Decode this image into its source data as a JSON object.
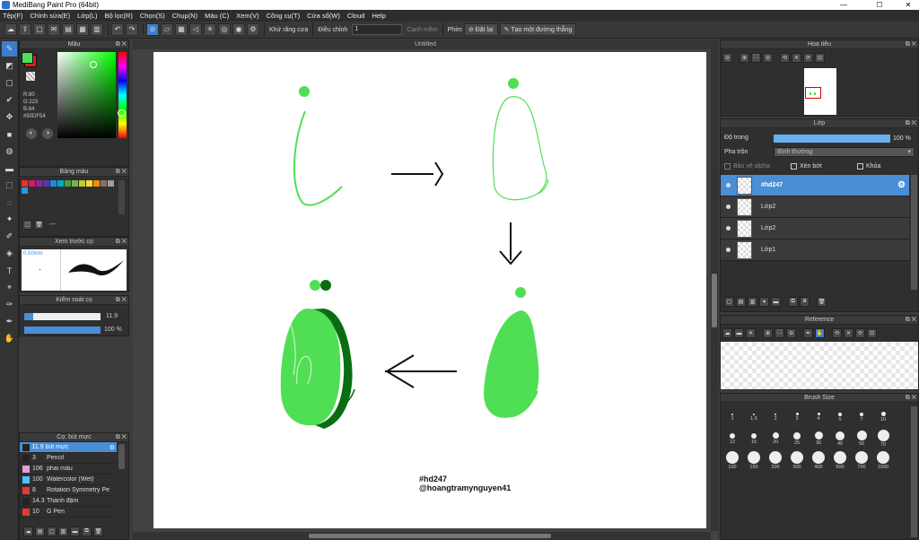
{
  "window": {
    "title": "MediBang Paint Pro (64bit)",
    "min": "—",
    "max": "☐",
    "close": "✕"
  },
  "menu": [
    "Tệp(F)",
    "Chỉnh sửa(E)",
    "Lớp(L)",
    "Bộ lọc(R)",
    "Chọn(S)",
    "Chụp(N)",
    "Màu (C)",
    "Xem(V)",
    "Công cụ(T)",
    "Cửa sổ(W)",
    "Cloud",
    "Help"
  ],
  "toolbar": {
    "antialias": "Khử răng cưa",
    "adjust_label": "Điều chỉnh",
    "adjust_value": "1",
    "smooth": "Cạnh mềm",
    "keyboard": "Phím",
    "reset": "Đặt lại",
    "straight_line": "Tạo một đường thẳng"
  },
  "color_panel": {
    "title": "Màu",
    "r": "R:80",
    "g": "G:223",
    "b": "B:84",
    "hex": "#50DF54",
    "primary": "#50DF54",
    "secondary": "#d82020"
  },
  "palette_panel": {
    "title": "Bảng màu",
    "dash": "---",
    "colors": [
      "#e8322c",
      "#d81b60",
      "#8e24aa",
      "#5e35b1",
      "#1e88e5",
      "#00acc1",
      "#43a047",
      "#7cb342",
      "#c0ca33",
      "#fdd835",
      "#fb8c00",
      "#8d6e63",
      "#9e9e9e",
      "#2196f3"
    ]
  },
  "brush_preview": {
    "title": "Xem trước cọ",
    "size": "0.50mm"
  },
  "brush_control": {
    "title": "Kiểm soát cọ",
    "size_value": "11.9",
    "size_fraction": 0.12,
    "opacity_value": "100 %",
    "opacity_fraction": 1.0
  },
  "brush_list": {
    "title": "Cọ: bút mực",
    "items": [
      {
        "size": "11.9",
        "name": "bút mực",
        "color": "#222222",
        "selected": true
      },
      {
        "size": "3",
        "name": "Pencil",
        "color": "#222222"
      },
      {
        "size": "106",
        "name": "phai màu",
        "color": "#e0a0d8"
      },
      {
        "size": "100",
        "name": "Watercolor (Wet)",
        "color": "#4fc3f7"
      },
      {
        "size": "8",
        "name": "Rotation Symmetry Pe",
        "color": "#e53935"
      },
      {
        "size": "14.3",
        "name": "Thanh đậm",
        "color": "#222222"
      },
      {
        "size": "10",
        "name": "G Pen",
        "color": "#e53935"
      }
    ]
  },
  "canvas": {
    "tab": "Untitled",
    "signature_1": "#hd247",
    "signature_2": "@hoangtramynguyen41"
  },
  "navigator": {
    "title": "Hoa tiêu"
  },
  "layer_panel": {
    "title": "Lớp",
    "opacity_label": "Độ trong",
    "opacity_value": "100 %",
    "opacity_fraction": 1.0,
    "blend_label": "Pha trộn",
    "blend_value": "Bình thường",
    "protect_alpha": "Bảo vệ alpha",
    "clip": "Xén bớt",
    "lock": "Khóa",
    "layers": [
      {
        "name": "#hd247",
        "selected": true
      },
      {
        "name": "Lớp2"
      },
      {
        "name": "Lớp2"
      },
      {
        "name": "Lớp1"
      }
    ]
  },
  "reference_panel": {
    "title": "Reference"
  },
  "brush_size_panel": {
    "title": "Brush Size",
    "sizes": [
      "1",
      "1.5",
      "2",
      "3",
      "4",
      "5",
      "7",
      "10",
      "12",
      "15",
      "20",
      "25",
      "30",
      "40",
      "50",
      "70",
      "100",
      "150",
      "200",
      "300",
      "400",
      "500",
      "700",
      "1000"
    ]
  },
  "colors": {
    "accent": "#4a8ed6",
    "green": "#50DF54",
    "dark_green": "#0a6e10"
  }
}
